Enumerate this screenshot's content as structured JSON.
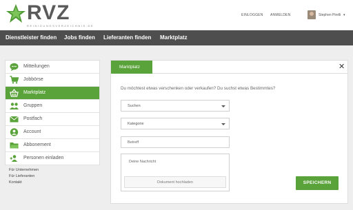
{
  "header": {
    "logo_text": "RVZ",
    "logo_subtitle": "REINIGUNGSVERZEICHNIS.DE",
    "login_label": "EINLOGGEN",
    "register_label": "ANMELDEN",
    "user_name": "Stephen Pirelli",
    "user_caret": "▾"
  },
  "nav": {
    "items": [
      {
        "label": "Dienstleister finden"
      },
      {
        "label": "Jobs finden"
      },
      {
        "label": "Lieferanten finden"
      },
      {
        "label": "Marktplatz"
      }
    ]
  },
  "sidebar": {
    "items": [
      {
        "label": "Mitteilungen",
        "icon": "chat-bubble-icon"
      },
      {
        "label": "Jobbörse",
        "icon": "briefcase-icon"
      },
      {
        "label": "Marktplatz",
        "icon": "basket-icon",
        "active": true
      },
      {
        "label": "Gruppen",
        "icon": "group-icon"
      },
      {
        "label": "Postfach",
        "icon": "envelope-icon"
      },
      {
        "label": "Account",
        "icon": "user-circle-icon"
      },
      {
        "label": "Abbonement",
        "icon": "folder-icon"
      },
      {
        "label": "Personen einladen",
        "icon": "add-user-icon"
      }
    ],
    "extra_links": [
      "Für Unternehmen",
      "Für Lieferanten",
      "Kontakt"
    ]
  },
  "panel": {
    "tab_label": "Marktplatz",
    "close_label": "✕",
    "question": "Du möchtest etwas verschenken oder verkaufen? Du suchst etwas Bestimmtes?",
    "select_type": "Suchen",
    "select_category": "Kategorie",
    "subject_placeholder": "Betreff",
    "message_placeholder": "Deine Nachricht",
    "upload_label": "Dokument hochladen",
    "save_label": "SPEICHERN"
  },
  "colors": {
    "accent": "#5aa23a",
    "nav_bg": "#4e4e4e",
    "page_bg": "#eeeeee"
  }
}
